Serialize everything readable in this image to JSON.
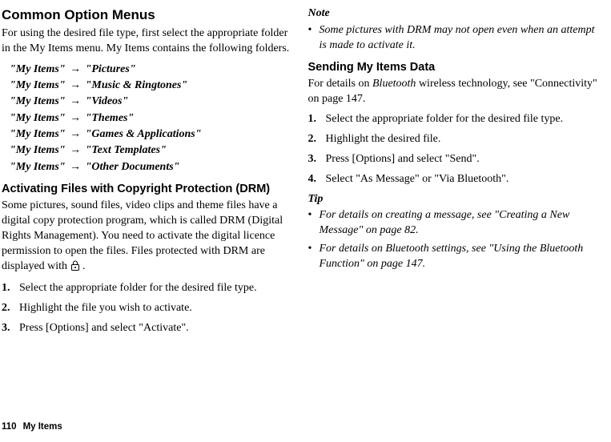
{
  "left": {
    "heading": "Common Option Menus",
    "intro": "For using the desired file type, first select the appropriate folder in the My Items menu. My Items contains the following folders.",
    "folders": [
      {
        "root": "\"My Items\"",
        "dest": "\"Pictures\""
      },
      {
        "root": "\"My Items\"",
        "dest": "\"Music & Ringtones\""
      },
      {
        "root": "\"My Items\"",
        "dest": "\"Videos\""
      },
      {
        "root": "\"My Items\"",
        "dest": "\"Themes\""
      },
      {
        "root": "\"My Items\"",
        "dest": "\"Games & Applications\""
      },
      {
        "root": "\"My Items\"",
        "dest": "\"Text Templates\""
      },
      {
        "root": "\"My Items\"",
        "dest": "\"Other Documents\""
      }
    ],
    "drm_heading": "Activating Files with Copyright Protection (DRM)",
    "drm_para_before_icon": "Some pictures, sound files, video clips and theme files have a digital copy protection program, which is called DRM (Digital Rights Management). You need to activate the digital licence permission to open the files. Files protected with DRM are displayed with ",
    "drm_para_after_icon": " .",
    "steps": [
      {
        "n": "1.",
        "t": "Select the appropriate folder for the desired file type."
      },
      {
        "n": "2.",
        "t": "Highlight the file you wish to activate."
      },
      {
        "n": "3.",
        "t": "Press [Options] and select \"Activate\"."
      }
    ]
  },
  "right": {
    "note_label": "Note",
    "note_item": "Some pictures with DRM may not open even when an attempt is made to activate it.",
    "send_heading": "Sending My Items Data",
    "send_para_a": "For details on ",
    "send_para_b": "Bluetooth",
    "send_para_c": " wireless technology, see \"Connectivity\" on page 147.",
    "steps": [
      {
        "n": "1.",
        "t": "Select the appropriate folder for the desired file type."
      },
      {
        "n": "2.",
        "t": "Highlight the desired file."
      },
      {
        "n": "3.",
        "t": "Press [Options] and select \"Send\"."
      },
      {
        "n": "4.",
        "t": "Select \"As Message\" or \"Via Bluetooth\"."
      }
    ],
    "tip_label": "Tip",
    "tips": [
      "For details on creating a message, see \"Creating a New Message\" on page 82.",
      "For details on Bluetooth settings, see \"Using the Bluetooth Function\" on page 147."
    ]
  },
  "footer": {
    "page": "110",
    "section": "My Items"
  },
  "arrow_glyph": "→"
}
